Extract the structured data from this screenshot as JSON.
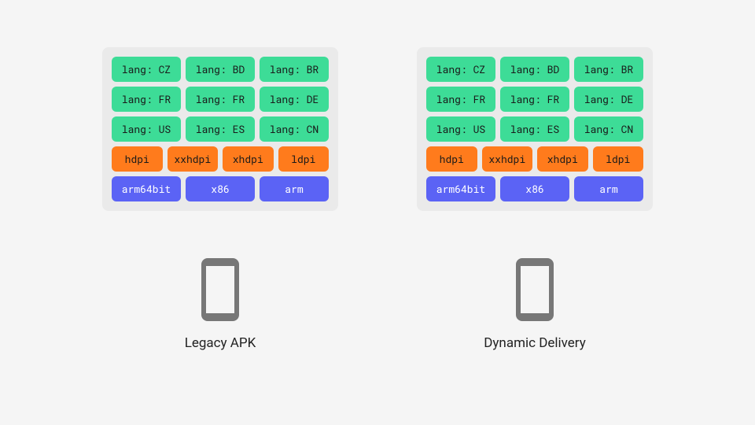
{
  "panels": [
    {
      "caption": "Legacy APK",
      "lang_rows": [
        [
          "lang: CZ",
          "lang: BD",
          "lang: BR"
        ],
        [
          "lang: FR",
          "lang: FR",
          "lang: DE"
        ],
        [
          "lang: US",
          "lang: ES",
          "lang: CN"
        ]
      ],
      "dpi_row": [
        "hdpi",
        "xxhdpi",
        "xhdpi",
        "ldpi"
      ],
      "arch_row": [
        "arm64bit",
        "x86",
        "arm"
      ]
    },
    {
      "caption": "Dynamic Delivery",
      "lang_rows": [
        [
          "lang: CZ",
          "lang: BD",
          "lang: BR"
        ],
        [
          "lang: FR",
          "lang: FR",
          "lang: DE"
        ],
        [
          "lang: US",
          "lang: ES",
          "lang: CN"
        ]
      ],
      "dpi_row": [
        "hdpi",
        "xxhdpi",
        "xhdpi",
        "ldpi"
      ],
      "arch_row": [
        "arm64bit",
        "x86",
        "arm"
      ]
    }
  ],
  "colors": {
    "lang": "#3ddc97",
    "dpi": "#ff7b1c",
    "arch": "#5b63f5"
  }
}
